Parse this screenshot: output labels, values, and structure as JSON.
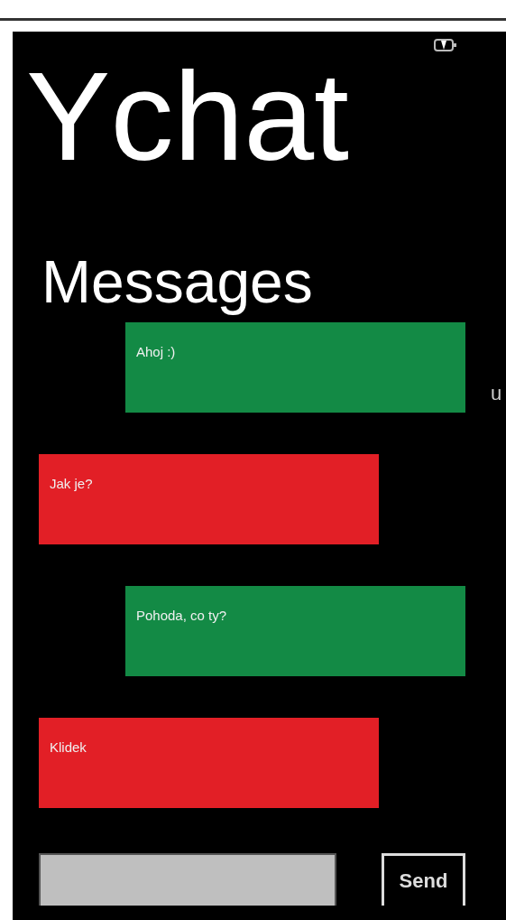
{
  "app_title": "Ychat",
  "page_title": "Messages",
  "next_page_peek": "u",
  "messages": [
    {
      "text": "Ahoj :)",
      "kind": "outgoing",
      "color": "#138a45"
    },
    {
      "text": "Jak je?",
      "kind": "incoming",
      "color": "#e21f26"
    },
    {
      "text": "Pohoda, co ty?",
      "kind": "outgoing",
      "color": "#138a45"
    },
    {
      "text": "Klidek",
      "kind": "incoming",
      "color": "#e21f26"
    }
  ],
  "composer": {
    "send_label": "Send"
  }
}
